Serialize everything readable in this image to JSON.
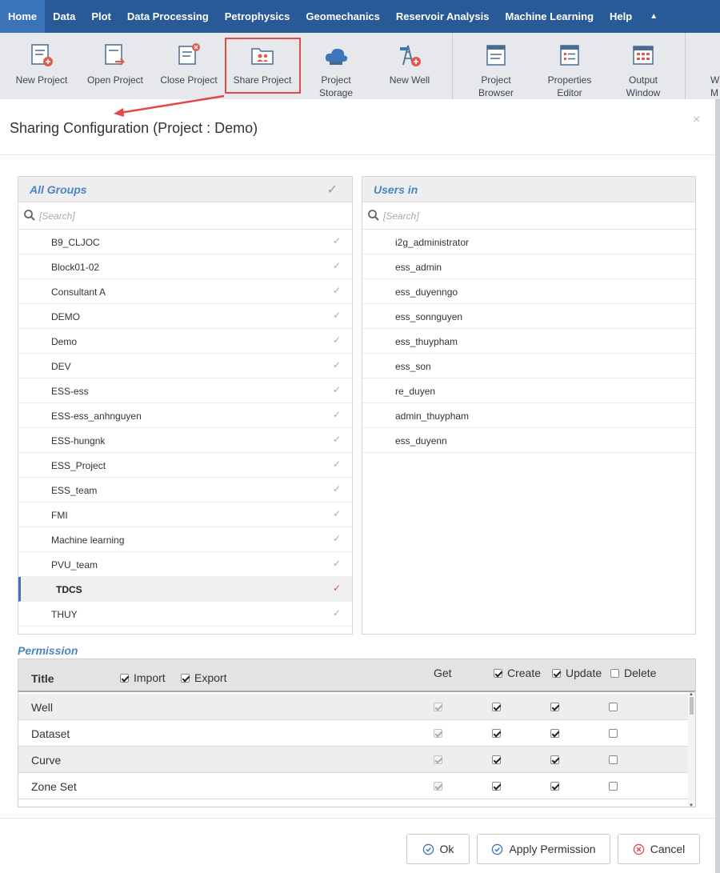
{
  "menu": {
    "items": [
      "Home",
      "Data",
      "Plot",
      "Data Processing",
      "Petrophysics",
      "Geomechanics",
      "Reservoir Analysis",
      "Machine Learning",
      "Help"
    ],
    "active_index": 0
  },
  "ribbon": {
    "buttons": [
      "New Project",
      "Open Project",
      "Close Project",
      "Share Project",
      "Project\nStorage",
      "New Well",
      "Project\nBrowser",
      "Properties\nEditor",
      "Output\nWindow",
      "W\nM"
    ],
    "highlighted": "Share Project"
  },
  "dialog": {
    "title": "Sharing Configuration (Project : Demo)",
    "close_glyph": "×"
  },
  "groups": {
    "title": "All Groups",
    "search_placeholder": "[Search]",
    "items": [
      "B9_CLJOC",
      "Block01-02",
      "Consultant A",
      "DEMO",
      "Demo",
      "DEV",
      "ESS-ess",
      "ESS-ess_anhnguyen",
      "ESS-hungnk",
      "ESS_Project",
      "ESS_team",
      "FMI",
      "Machine learning",
      "PVU_team",
      "TDCS",
      "THUY"
    ],
    "selected": "TDCS"
  },
  "users": {
    "title": "Users in",
    "search_placeholder": "[Search]",
    "items": [
      "i2g_administrator",
      "ess_admin",
      "ess_duyenngo",
      "ess_sonnguyen",
      "ess_thuypham",
      "ess_son",
      "re_duyen",
      "admin_thuypham",
      "ess_duyenn"
    ]
  },
  "permission": {
    "section_title": "Permission",
    "header": {
      "title": "Title",
      "import": "Import",
      "export": "Export",
      "get": "Get",
      "create": "Create",
      "update": "Update",
      "delete": "Delete",
      "import_checked": true,
      "export_checked": true,
      "create_checked": true,
      "update_checked": true,
      "delete_checked": false
    },
    "rows": [
      {
        "name": "Well",
        "get": true,
        "create": true,
        "update": true,
        "delete": false
      },
      {
        "name": "Dataset",
        "get": true,
        "create": true,
        "update": true,
        "delete": false
      },
      {
        "name": "Curve",
        "get": true,
        "create": true,
        "update": true,
        "delete": false
      },
      {
        "name": "Zone Set",
        "get": true,
        "create": true,
        "update": true,
        "delete": false
      }
    ]
  },
  "footer": {
    "ok": "Ok",
    "apply": "Apply Permission",
    "cancel": "Cancel"
  },
  "colors": {
    "menu_bar": "#275a96",
    "accent": "#4b84c4",
    "highlight": "#e2494b"
  }
}
